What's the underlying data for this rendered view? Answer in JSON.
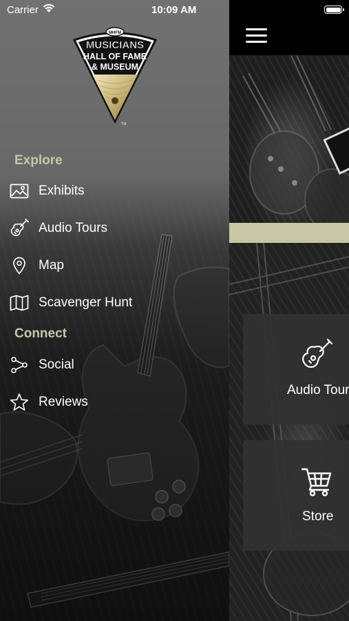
{
  "status_bar": {
    "carrier": "Carrier",
    "time": "10:09 AM"
  },
  "logo": {
    "line1": "MUSICIANS",
    "line2": "HALL OF FAME",
    "line3": "& MUSEUM",
    "badge": "MHFM"
  },
  "drawer": {
    "sections": [
      {
        "heading": "Explore",
        "items": [
          {
            "label": "Exhibits",
            "icon": "image-icon"
          },
          {
            "label": "Audio Tours",
            "icon": "guitar-icon"
          },
          {
            "label": "Map",
            "icon": "map-pin-icon"
          },
          {
            "label": "Scavenger Hunt",
            "icon": "folded-map-icon"
          }
        ]
      },
      {
        "heading": "Connect",
        "items": [
          {
            "label": "Social",
            "icon": "share-icon"
          },
          {
            "label": "Reviews",
            "icon": "star-icon"
          }
        ]
      }
    ]
  },
  "main": {
    "tiles": [
      {
        "label": "Audio Tours",
        "icon": "guitar-icon"
      },
      {
        "label": "Store",
        "icon": "cart-icon"
      }
    ]
  },
  "colors": {
    "accent": "#c9c6a6",
    "topbar": "#000000",
    "tile_bg": "#333333"
  }
}
